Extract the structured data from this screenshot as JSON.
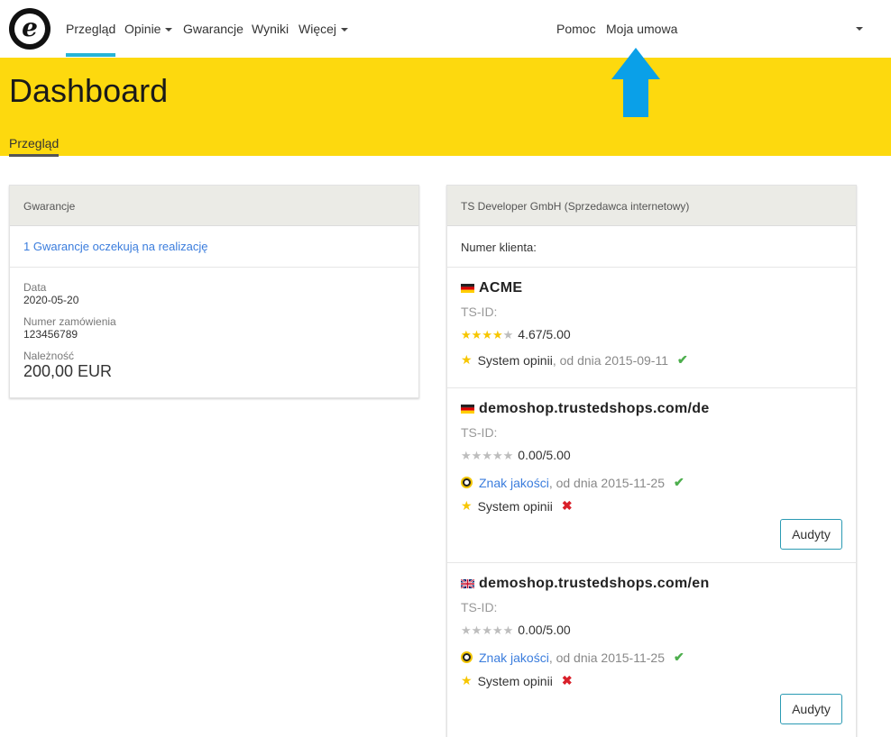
{
  "nav": {
    "items": [
      {
        "label": "Przegląd"
      },
      {
        "label": "Opinie"
      },
      {
        "label": "Gwarancje"
      },
      {
        "label": "Wyniki"
      },
      {
        "label": "Więcej"
      }
    ],
    "help_label": "Pomoc",
    "contract_label": "Moja umowa",
    "accent_color": "#27b4d6"
  },
  "header": {
    "title": "Dashboard",
    "subtab": "Przegląd",
    "background_color": "#fdd90e"
  },
  "guarantees": {
    "heading": "Gwarancje",
    "pending_link": "1 Gwarancje oczekują na realizację",
    "date_label": "Data",
    "date_value": "2020-05-20",
    "order_label": "Numer zamówienia",
    "order_value": "123456789",
    "amount_label": "Należność",
    "amount_value": "200,00 EUR"
  },
  "account": {
    "heading": "TS Developer GmbH (Sprzedawca internetowy)",
    "customer_number_label": "Numer klienta:",
    "shops": [
      {
        "flag": "germany-flag",
        "name": "ACME",
        "tsid_label": "TS-ID:",
        "rating": "4.67/5.00",
        "stars_filled": 4.67,
        "review_label": "System opinii",
        "review_since": ", od dnia 2015-09-11"
      },
      {
        "flag": "germany-flag",
        "name": "demoshop.trustedshops.com/de",
        "tsid_label": "TS-ID:",
        "rating": "0.00/5.00",
        "stars_filled": 0,
        "seal_label": "Znak jakości",
        "seal_since": ", od dnia 2015-11-25",
        "review_label": "System opinii",
        "audit_button": "Audyty"
      },
      {
        "flag": "uk-flag",
        "name": "demoshop.trustedshops.com/en",
        "tsid_label": "TS-ID:",
        "rating": "0.00/5.00",
        "stars_filled": 0,
        "seal_label": "Znak jakości",
        "seal_since": ", od dnia 2015-11-25",
        "review_label": "System opinii",
        "audit_button": "Audyty"
      }
    ]
  },
  "icons": {
    "logo": "trusted-shops-e-logo",
    "arrow": "up-arrow-icon",
    "check": "✔",
    "cross": "✖"
  }
}
